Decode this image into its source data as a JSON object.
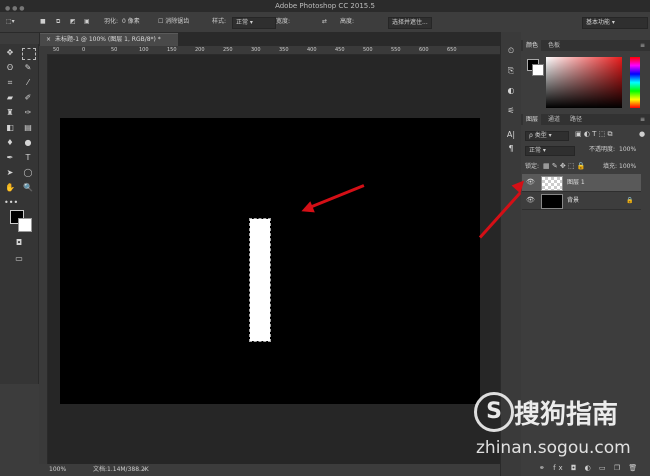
{
  "window": {
    "title": "Adobe Photoshop CC 2015.5"
  },
  "options_bar": {
    "feather_label": "羽化:",
    "feather_value": "0 像素",
    "antialias_label": "消除锯齿",
    "style_label": "样式:",
    "style_value": "正常",
    "width_label": "宽度:",
    "height_label": "高度:",
    "select_mask_button": "选择并遮住...",
    "workspace_value": "基本功能"
  },
  "document": {
    "tab_title": "未标题-1 @ 100% (图层 1, RGB/8*) *",
    "zoom": "100%",
    "doc_info": "文档:1.14M/388.2K",
    "ruler_marks": [
      "50",
      "0",
      "50",
      "100",
      "150",
      "200",
      "250",
      "300",
      "350",
      "400",
      "450",
      "500",
      "550",
      "600",
      "650"
    ]
  },
  "panels": {
    "color_tab": "颜色",
    "swatches_tab": "色板",
    "layers_tab": "图层",
    "channels_tab": "通道",
    "paths_tab": "路径",
    "filter_kind": "类型",
    "blend_mode": "正常",
    "opacity_label": "不透明度:",
    "opacity_value": "100%",
    "lock_label": "锁定:",
    "fill_label": "填充:",
    "fill_value": "100%",
    "layers": [
      {
        "name": "图层 1",
        "selected": true
      },
      {
        "name": "背景",
        "selected": false
      }
    ]
  },
  "watermark": {
    "brand": "搜狗指南",
    "url": "zhinan.sogou.com"
  },
  "colors": {
    "annotation_arrow": "#d40f16",
    "foreground": "#000000",
    "background": "#ffffff"
  }
}
